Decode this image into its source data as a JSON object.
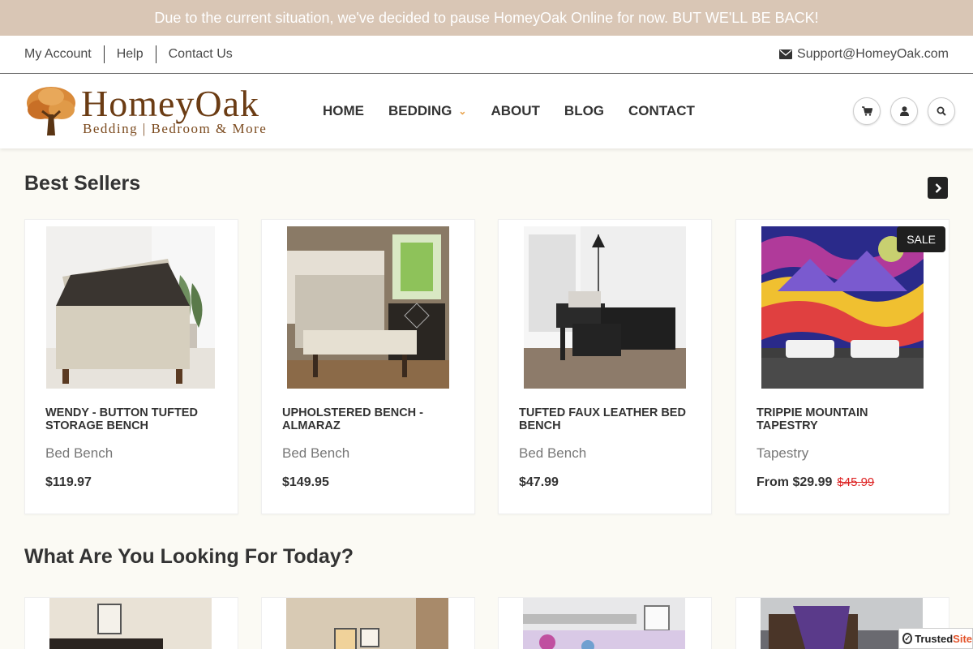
{
  "announcement": "Due to the current situation, we've decided to pause HomeyOak Online for now. BUT WE'LL BE BACK!",
  "utility": {
    "links": [
      "My Account",
      "Help",
      "Contact Us"
    ],
    "support_email": "Support@HomeyOak.com"
  },
  "header": {
    "brand": "HomeyOak",
    "tagline": "Bedding | Bedroom & More",
    "nav": [
      {
        "label": "HOME"
      },
      {
        "label": "BEDDING"
      },
      {
        "label": "ABOUT"
      },
      {
        "label": "BLOG"
      },
      {
        "label": "CONTACT"
      }
    ],
    "icons": [
      "cart-icon",
      "user-icon",
      "search-icon"
    ]
  },
  "best_sellers": {
    "title": "Best Sellers",
    "products": [
      {
        "name": "Wendy - Button Tufted Storage Bench",
        "type": "Bed Bench",
        "price": "$119.97",
        "compare": ""
      },
      {
        "name": "Upholstered Bench - Almaraz",
        "type": "Bed Bench",
        "price": "$149.95",
        "compare": ""
      },
      {
        "name": "Tufted Faux Leather Bed Bench",
        "type": "Bed Bench",
        "price": "$47.99",
        "compare": ""
      },
      {
        "name": "Trippie Mountain Tapestry",
        "type": "Tapestry",
        "price": "From $29.99",
        "compare": "$45.99",
        "badge": "SALE"
      }
    ]
  },
  "categories": {
    "title": "What Are You Looking For Today?"
  },
  "trusted": {
    "label": "Trusted",
    "suffix": "Site"
  },
  "colors": {
    "announcement_bg": "#d9c6b5",
    "sale_price": "#d22222",
    "nav_chevron": "#e8a24a"
  }
}
